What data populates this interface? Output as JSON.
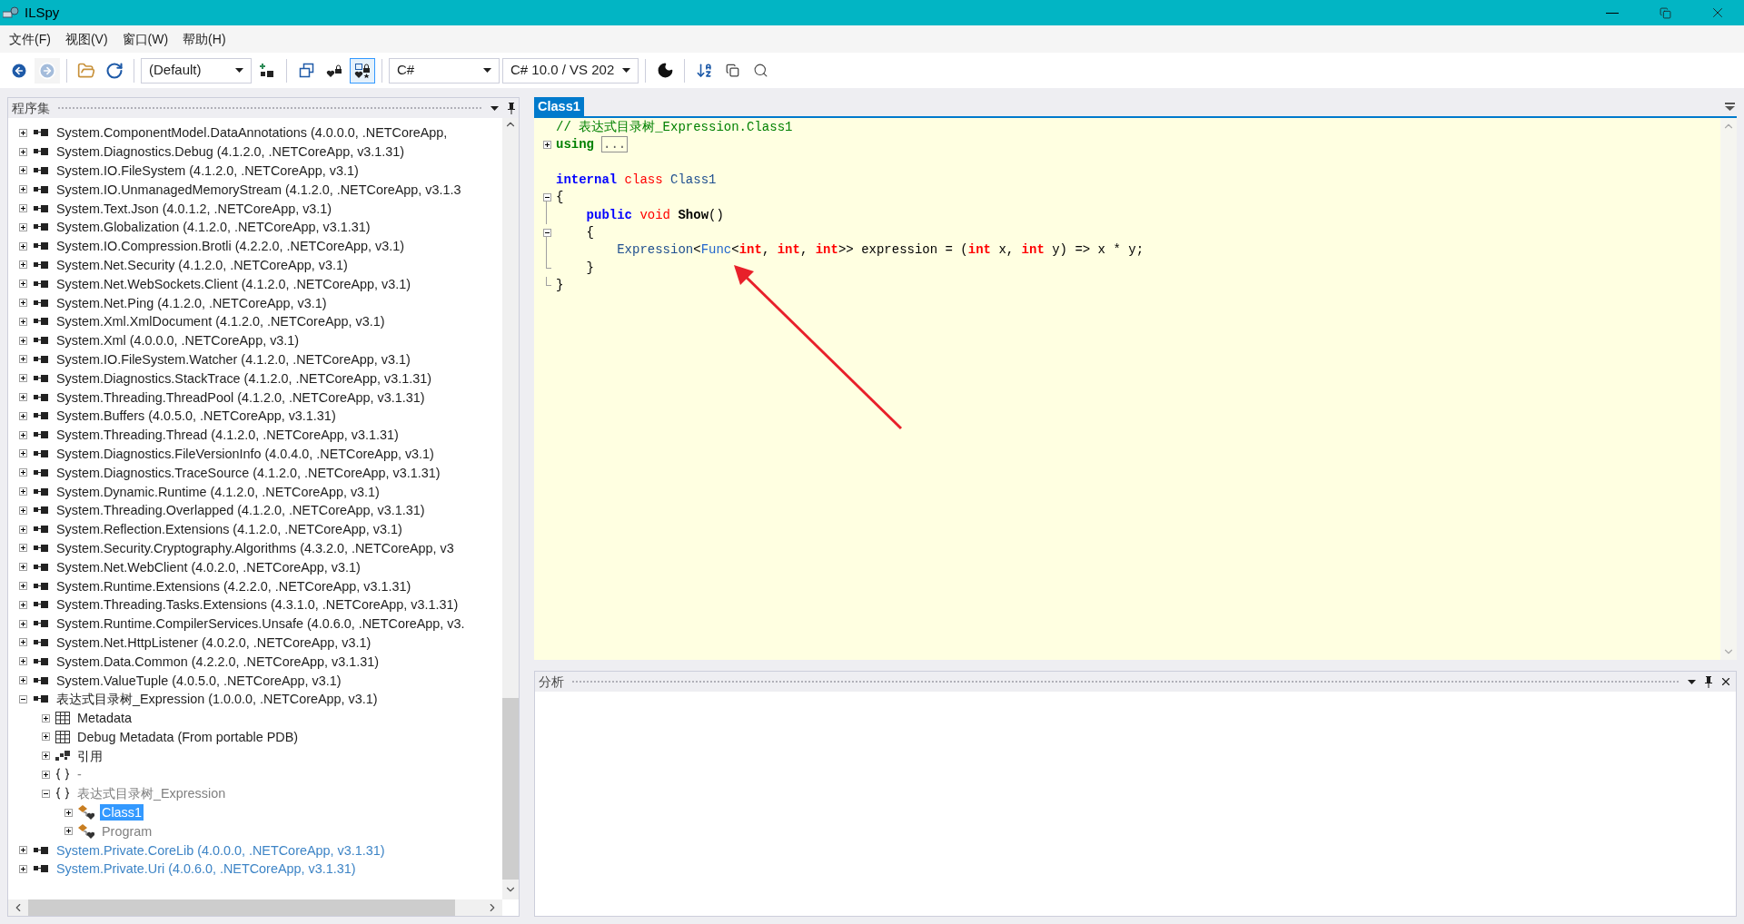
{
  "window": {
    "title": "ILSpy"
  },
  "menu": [
    {
      "label": "文件(F)"
    },
    {
      "label": "视图(V)"
    },
    {
      "label": "窗口(W)"
    },
    {
      "label": "帮助(H)"
    }
  ],
  "toolbar": {
    "forward": {
      "disabled": true
    },
    "filter": {
      "value": "(Default)"
    },
    "api_visibility": [
      {
        "selected": false
      },
      {
        "selected": true
      }
    ],
    "language": {
      "value": "C#"
    },
    "version": {
      "value": "C# 10.0 / VS 202"
    }
  },
  "assemblies_panel": {
    "title": "程序集",
    "tree": [
      {
        "label": "System.ComponentModel.DataAnnotations (4.0.0.0, .NETCoreApp,",
        "kind": "assembly",
        "color": "#1e1e1e",
        "expanded": false,
        "selected": false
      },
      {
        "label": "System.Diagnostics.Debug (4.1.2.0, .NETCoreApp, v3.1.31)",
        "kind": "assembly",
        "color": "#1e1e1e",
        "expanded": false,
        "selected": false
      },
      {
        "label": "System.IO.FileSystem (4.1.2.0, .NETCoreApp, v3.1)",
        "kind": "assembly",
        "color": "#1e1e1e",
        "expanded": false,
        "selected": false
      },
      {
        "label": "System.IO.UnmanagedMemoryStream (4.1.2.0, .NETCoreApp, v3.1.3",
        "kind": "assembly",
        "color": "#1e1e1e",
        "expanded": false,
        "selected": false
      },
      {
        "label": "System.Text.Json (4.0.1.2, .NETCoreApp, v3.1)",
        "kind": "assembly",
        "color": "#1e1e1e",
        "expanded": false,
        "selected": false
      },
      {
        "label": "System.Globalization (4.1.2.0, .NETCoreApp, v3.1.31)",
        "kind": "assembly",
        "color": "#1e1e1e",
        "expanded": false,
        "selected": false
      },
      {
        "label": "System.IO.Compression.Brotli (4.2.2.0, .NETCoreApp, v3.1)",
        "kind": "assembly",
        "color": "#1e1e1e",
        "expanded": false,
        "selected": false
      },
      {
        "label": "System.Net.Security (4.1.2.0, .NETCoreApp, v3.1)",
        "kind": "assembly",
        "color": "#1e1e1e",
        "expanded": false,
        "selected": false
      },
      {
        "label": "System.Net.WebSockets.Client (4.1.2.0, .NETCoreApp, v3.1)",
        "kind": "assembly",
        "color": "#1e1e1e",
        "expanded": false,
        "selected": false
      },
      {
        "label": "System.Net.Ping (4.1.2.0, .NETCoreApp, v3.1)",
        "kind": "assembly",
        "color": "#1e1e1e",
        "expanded": false,
        "selected": false
      },
      {
        "label": "System.Xml.XmlDocument (4.1.2.0, .NETCoreApp, v3.1)",
        "kind": "assembly",
        "color": "#1e1e1e",
        "expanded": false,
        "selected": false
      },
      {
        "label": "System.Xml (4.0.0.0, .NETCoreApp, v3.1)",
        "kind": "assembly",
        "color": "#1e1e1e",
        "expanded": false,
        "selected": false
      },
      {
        "label": "System.IO.FileSystem.Watcher (4.1.2.0, .NETCoreApp, v3.1)",
        "kind": "assembly",
        "color": "#1e1e1e",
        "expanded": false,
        "selected": false
      },
      {
        "label": "System.Diagnostics.StackTrace (4.1.2.0, .NETCoreApp, v3.1.31)",
        "kind": "assembly",
        "color": "#1e1e1e",
        "expanded": false,
        "selected": false
      },
      {
        "label": "System.Threading.ThreadPool (4.1.2.0, .NETCoreApp, v3.1.31)",
        "kind": "assembly",
        "color": "#1e1e1e",
        "expanded": false,
        "selected": false
      },
      {
        "label": "System.Buffers (4.0.5.0, .NETCoreApp, v3.1.31)",
        "kind": "assembly",
        "color": "#1e1e1e",
        "expanded": false,
        "selected": false
      },
      {
        "label": "System.Threading.Thread (4.1.2.0, .NETCoreApp, v3.1.31)",
        "kind": "assembly",
        "color": "#1e1e1e",
        "expanded": false,
        "selected": false
      },
      {
        "label": "System.Diagnostics.FileVersionInfo (4.0.4.0, .NETCoreApp, v3.1)",
        "kind": "assembly",
        "color": "#1e1e1e",
        "expanded": false,
        "selected": false
      },
      {
        "label": "System.Diagnostics.TraceSource (4.1.2.0, .NETCoreApp, v3.1.31)",
        "kind": "assembly",
        "color": "#1e1e1e",
        "expanded": false,
        "selected": false
      },
      {
        "label": "System.Dynamic.Runtime (4.1.2.0, .NETCoreApp, v3.1)",
        "kind": "assembly",
        "color": "#1e1e1e",
        "expanded": false,
        "selected": false
      },
      {
        "label": "System.Threading.Overlapped (4.1.2.0, .NETCoreApp, v3.1.31)",
        "kind": "assembly",
        "color": "#1e1e1e",
        "expanded": false,
        "selected": false
      },
      {
        "label": "System.Reflection.Extensions (4.1.2.0, .NETCoreApp, v3.1)",
        "kind": "assembly",
        "color": "#1e1e1e",
        "expanded": false,
        "selected": false
      },
      {
        "label": "System.Security.Cryptography.Algorithms (4.3.2.0, .NETCoreApp, v3",
        "kind": "assembly",
        "color": "#1e1e1e",
        "expanded": false,
        "selected": false
      },
      {
        "label": "System.Net.WebClient (4.0.2.0, .NETCoreApp, v3.1)",
        "kind": "assembly",
        "color": "#1e1e1e",
        "expanded": false,
        "selected": false
      },
      {
        "label": "System.Runtime.Extensions (4.2.2.0, .NETCoreApp, v3.1.31)",
        "kind": "assembly",
        "color": "#1e1e1e",
        "expanded": false,
        "selected": false
      },
      {
        "label": "System.Threading.Tasks.Extensions (4.3.1.0, .NETCoreApp, v3.1.31)",
        "kind": "assembly",
        "color": "#1e1e1e",
        "expanded": false,
        "selected": false
      },
      {
        "label": "System.Runtime.CompilerServices.Unsafe (4.0.6.0, .NETCoreApp, v3.",
        "kind": "assembly",
        "color": "#1e1e1e",
        "expanded": false,
        "selected": false
      },
      {
        "label": "System.Net.HttpListener (4.0.2.0, .NETCoreApp, v3.1)",
        "kind": "assembly",
        "color": "#1e1e1e",
        "expanded": false,
        "selected": false
      },
      {
        "label": "System.Data.Common (4.2.2.0, .NETCoreApp, v3.1.31)",
        "kind": "assembly",
        "color": "#1e1e1e",
        "expanded": false,
        "selected": false
      },
      {
        "label": "System.ValueTuple (4.0.5.0, .NETCoreApp, v3.1)",
        "kind": "assembly",
        "color": "#1e1e1e",
        "expanded": false,
        "selected": false
      },
      {
        "label": "表达式目录树_Expression (1.0.0.0, .NETCoreApp, v3.1)",
        "kind": "assembly",
        "color": "#1e1e1e",
        "expanded": true,
        "selected": false,
        "children": [
          {
            "label": "Metadata",
            "kind": "metadata",
            "color": "#1e1e1e",
            "expanded": false,
            "selected": false
          },
          {
            "label": "Debug Metadata (From portable PDB)",
            "kind": "metadata",
            "color": "#1e1e1e",
            "expanded": false,
            "selected": false
          },
          {
            "label": "引用",
            "kind": "references",
            "color": "#1e1e1e",
            "expanded": false,
            "selected": false
          },
          {
            "label": "-",
            "kind": "namespace",
            "color": "#808080",
            "expanded": false,
            "selected": false
          },
          {
            "label": "表达式目录树_Expression",
            "kind": "namespace",
            "color": "#808080",
            "expanded": true,
            "selected": false,
            "children": [
              {
                "label": "Class1",
                "kind": "class",
                "expanded": false,
                "selected": true
              },
              {
                "label": "Program",
                "kind": "class",
                "color": "#808080",
                "expanded": false,
                "selected": false
              }
            ]
          }
        ]
      },
      {
        "label": "System.Private.CoreLib (4.0.0.0, .NETCoreApp, v3.1.31)",
        "kind": "assembly",
        "color": "#3d84c6",
        "expanded": false,
        "selected": false
      },
      {
        "label": "System.Private.Uri (4.0.6.0, .NETCoreApp, v3.1.31)",
        "kind": "assembly",
        "color": "#3d84c6",
        "expanded": false,
        "selected": false
      }
    ]
  },
  "editor": {
    "tabs": [
      {
        "label": "Class1",
        "selected": true
      }
    ],
    "lines": [
      {
        "kind": "plain",
        "tokens": [
          {
            "kind": "comment",
            "text": "// 表达式目录树_Expression.Class1"
          }
        ]
      },
      {
        "kind": "fold-closed",
        "tokens": [
          {
            "kind": "directive",
            "text": "using"
          },
          {
            "kind": "folded",
            "text": "..."
          }
        ]
      },
      {
        "kind": "plain"
      },
      {
        "kind": "plain",
        "tokens": [
          {
            "kind": "keyword",
            "text": "internal"
          },
          {
            "kind": "modifier",
            "text": " class"
          },
          {
            "kind": "type",
            "text": " Class1"
          }
        ]
      },
      {
        "kind": "fold-open",
        "tokens": [
          {
            "kind": "plain",
            "text": "{"
          }
        ]
      },
      {
        "kind": "inner",
        "tokens": [
          {
            "kind": "keyword",
            "text": "    public"
          },
          {
            "kind": "modifier",
            "text": " void"
          },
          {
            "kind": "method",
            "text": " Show"
          },
          {
            "kind": "plain",
            "text": "()"
          }
        ]
      },
      {
        "kind": "fold-open",
        "tokens": [
          {
            "kind": "plain",
            "text": "    {"
          }
        ]
      },
      {
        "kind": "inner",
        "tokens": [
          {
            "kind": "type",
            "text": "        Expression"
          },
          {
            "kind": "plain",
            "text": "<"
          },
          {
            "kind": "delegate",
            "text": "Func"
          },
          {
            "kind": "plain",
            "text": "<"
          },
          {
            "kind": "builtin",
            "text": "int"
          },
          {
            "kind": "plain",
            "text": ", "
          },
          {
            "kind": "builtin",
            "text": "int"
          },
          {
            "kind": "plain",
            "text": ", "
          },
          {
            "kind": "builtin",
            "text": "int"
          },
          {
            "kind": "plain",
            "text": ">> expression = ("
          },
          {
            "kind": "builtin",
            "text": "int"
          },
          {
            "kind": "plain",
            "text": " x, "
          },
          {
            "kind": "builtin",
            "text": "int"
          },
          {
            "kind": "plain",
            "text": " y) => x * y;"
          }
        ]
      },
      {
        "kind": "fold-end",
        "tokens": [
          {
            "kind": "plain",
            "text": "    }"
          }
        ]
      },
      {
        "kind": "fold-end",
        "tokens": [
          {
            "kind": "plain",
            "text": "}"
          }
        ]
      }
    ]
  },
  "analyzer_panel": {
    "title": "分析"
  }
}
